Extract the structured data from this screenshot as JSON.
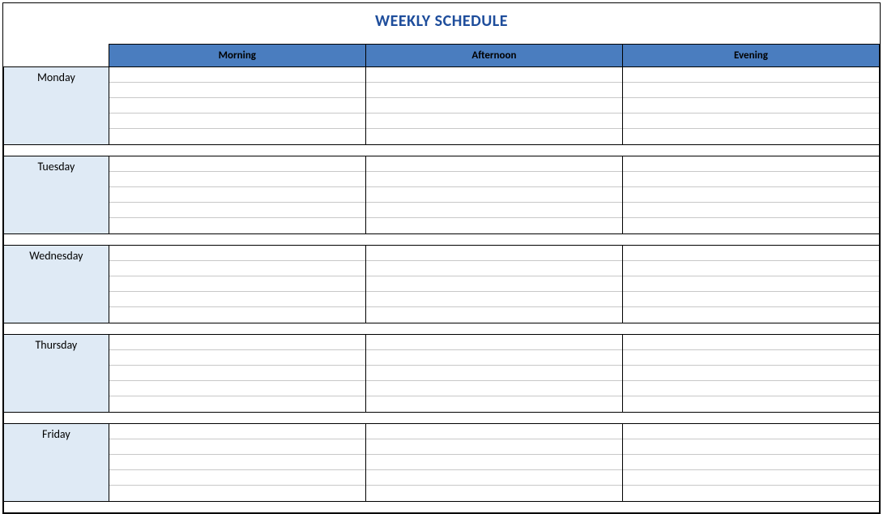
{
  "title": "WEEKLY SCHEDULE",
  "periods": [
    "Morning",
    "Afternoon",
    "Evening"
  ],
  "days": [
    "Monday",
    "Tuesday",
    "Wednesday",
    "Thursday",
    "Friday"
  ],
  "rows_per_day": 5
}
